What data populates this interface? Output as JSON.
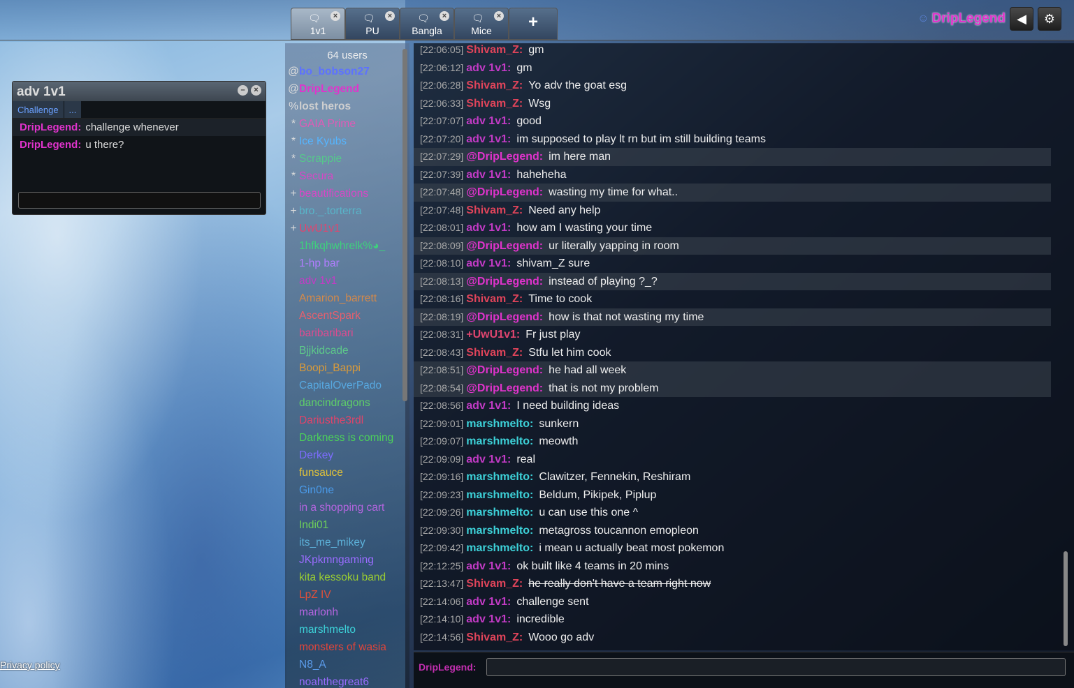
{
  "tabs": [
    {
      "label": "1v1",
      "active": true
    },
    {
      "label": "PU",
      "active": false
    },
    {
      "label": "Bangla",
      "active": false
    },
    {
      "label": "Mice",
      "active": false
    }
  ],
  "newtab_icon": "+",
  "header": {
    "username": "DripLegend",
    "user_icon": "user-icon",
    "sound_icon": "speaker-icon",
    "settings_icon": "gear-icon"
  },
  "pm": {
    "title": "adv 1v1",
    "tabs": [
      "Challenge",
      "..."
    ],
    "messages": [
      {
        "name": "DripLegend:",
        "text": "challenge whenever"
      },
      {
        "name": "DripLegend:",
        "text": "u there?"
      }
    ]
  },
  "privacy": "Privacy policy",
  "userlist": {
    "count": "64 users",
    "users": [
      {
        "rank": "@",
        "name": "bo_bobson27",
        "color": "#5d72ff",
        "bold": true
      },
      {
        "rank": "@",
        "name": "DripLegend",
        "color": "#e033cc",
        "bold": true
      },
      {
        "rank": "%",
        "name": "lost heros",
        "color": "#cfcfcf",
        "bold": true
      },
      {
        "rank": "*",
        "name": "GAIA Prime",
        "color": "#e05ab7"
      },
      {
        "rank": "*",
        "name": "Ice Kyubs",
        "color": "#55b5ff"
      },
      {
        "rank": "*",
        "name": "Scrappie",
        "color": "#55c98a"
      },
      {
        "rank": "*",
        "name": "Secura",
        "color": "#d946c6"
      },
      {
        "rank": "+",
        "name": "beautifications",
        "color": "#d946c6"
      },
      {
        "rank": "+",
        "name": "bro._.torterra",
        "color": "#58b5c9"
      },
      {
        "rank": "+",
        "name": "UwU1v1",
        "color": "#e0456f"
      },
      {
        "rank": "",
        "name": "1hfkqhwhrelk%◕_",
        "color": "#3ed17c"
      },
      {
        "rank": "",
        "name": "1-hp bar",
        "color": "#b17dff"
      },
      {
        "rank": "",
        "name": "adv 1v1",
        "color": "#c33bc6"
      },
      {
        "rank": "",
        "name": "Amarion_barrett",
        "color": "#d4894a"
      },
      {
        "rank": "",
        "name": "AscentSpark",
        "color": "#e85f6d"
      },
      {
        "rank": "",
        "name": "baribaribari",
        "color": "#e04a8f"
      },
      {
        "rank": "",
        "name": "Bjjkidcade",
        "color": "#5dc98a"
      },
      {
        "rank": "",
        "name": "Boopi_Bappi",
        "color": "#d99a3a"
      },
      {
        "rank": "",
        "name": "CapitalOverPado",
        "color": "#57a8e0"
      },
      {
        "rank": "",
        "name": "dancindragons",
        "color": "#5fcf68"
      },
      {
        "rank": "",
        "name": "Dariusthe3rdl",
        "color": "#e0446a"
      },
      {
        "rank": "",
        "name": "Darkness is coming",
        "color": "#4cd05a"
      },
      {
        "rank": "",
        "name": "Derkey",
        "color": "#7d6cff"
      },
      {
        "rank": "",
        "name": "funsauce",
        "color": "#e0c23a"
      },
      {
        "rank": "",
        "name": "Gin0ne",
        "color": "#4a9ae8"
      },
      {
        "rank": "",
        "name": "in a shopping cart",
        "color": "#b565e0"
      },
      {
        "rank": "",
        "name": "Indi01",
        "color": "#6ecf5a"
      },
      {
        "rank": "",
        "name": "its_me_mikey",
        "color": "#5cb0d8"
      },
      {
        "rank": "",
        "name": "JKpkmngaming",
        "color": "#9a6cff"
      },
      {
        "rank": "",
        "name": "kita kessoku band",
        "color": "#9acd32"
      },
      {
        "rank": "",
        "name": "LpZ IV",
        "color": "#e0503a"
      },
      {
        "rank": "",
        "name": "marlonh",
        "color": "#b565e0"
      },
      {
        "rank": "",
        "name": "marshmelto",
        "color": "#3dd1d8"
      },
      {
        "rank": "",
        "name": "monsters of wasia",
        "color": "#e0453a"
      },
      {
        "rank": "",
        "name": "N8_A",
        "color": "#5a9ae8"
      },
      {
        "rank": "",
        "name": "noahthegreat6",
        "color": "#9a6cff"
      }
    ]
  },
  "chat": [
    {
      "ts": "[22:06:05]",
      "nick": "Shivam_Z:",
      "color": "#e0445a",
      "text": "gm",
      "me": false
    },
    {
      "ts": "[22:06:12]",
      "nick": "adv 1v1:",
      "color": "#c33bc6",
      "text": "gm",
      "me": false
    },
    {
      "ts": "[22:06:28]",
      "nick": "Shivam_Z:",
      "color": "#e0445a",
      "text": "Yo adv the goat esg",
      "me": false
    },
    {
      "ts": "[22:06:33]",
      "nick": "Shivam_Z:",
      "color": "#e0445a",
      "text": "Wsg",
      "me": false
    },
    {
      "ts": "[22:07:07]",
      "nick": "adv 1v1:",
      "color": "#c33bc6",
      "text": "good",
      "me": false
    },
    {
      "ts": "[22:07:20]",
      "nick": "adv 1v1:",
      "color": "#c33bc6",
      "text": "im supposed to play lt rn but im still building teams",
      "me": false
    },
    {
      "ts": "[22:07:29]",
      "nick": "@DripLegend:",
      "color": "#e033cc",
      "text": "im here man",
      "me": true
    },
    {
      "ts": "[22:07:39]",
      "nick": "adv 1v1:",
      "color": "#c33bc6",
      "text": "haheheha",
      "me": false
    },
    {
      "ts": "[22:07:48]",
      "nick": "@DripLegend:",
      "color": "#e033cc",
      "text": "wasting my time for what..",
      "me": true
    },
    {
      "ts": "[22:07:48]",
      "nick": "Shivam_Z:",
      "color": "#e0445a",
      "text": "Need any help",
      "me": false
    },
    {
      "ts": "[22:08:01]",
      "nick": "adv 1v1:",
      "color": "#c33bc6",
      "text": "how am I wasting your time",
      "me": false
    },
    {
      "ts": "[22:08:09]",
      "nick": "@DripLegend:",
      "color": "#e033cc",
      "text": "ur literally yapping in room",
      "me": true
    },
    {
      "ts": "[22:08:10]",
      "nick": "adv 1v1:",
      "color": "#c33bc6",
      "text": "shivam_Z sure",
      "me": false
    },
    {
      "ts": "[22:08:13]",
      "nick": "@DripLegend:",
      "color": "#e033cc",
      "text": "instead of playing ?_?",
      "me": true
    },
    {
      "ts": "[22:08:16]",
      "nick": "Shivam_Z:",
      "color": "#e0445a",
      "text": "Time to cook",
      "me": false
    },
    {
      "ts": "[22:08:19]",
      "nick": "@DripLegend:",
      "color": "#e033cc",
      "text": "how is that not wasting my time",
      "me": true
    },
    {
      "ts": "[22:08:31]",
      "nick": "+UwU1v1:",
      "color": "#e0456f",
      "text": "Fr just play",
      "me": false
    },
    {
      "ts": "[22:08:43]",
      "nick": "Shivam_Z:",
      "color": "#e0445a",
      "text": "Stfu let him cook",
      "me": false
    },
    {
      "ts": "[22:08:51]",
      "nick": "@DripLegend:",
      "color": "#e033cc",
      "text": "he had all week",
      "me": true
    },
    {
      "ts": "[22:08:54]",
      "nick": "@DripLegend:",
      "color": "#e033cc",
      "text": "that is not my problem",
      "me": true
    },
    {
      "ts": "[22:08:56]",
      "nick": "adv 1v1:",
      "color": "#c33bc6",
      "text": "I need building ideas",
      "me": false
    },
    {
      "ts": "[22:09:01]",
      "nick": "marshmelto:",
      "color": "#3dd1d8",
      "text": "sunkern",
      "me": false
    },
    {
      "ts": "[22:09:07]",
      "nick": "marshmelto:",
      "color": "#3dd1d8",
      "text": "meowth",
      "me": false
    },
    {
      "ts": "[22:09:09]",
      "nick": "adv 1v1:",
      "color": "#c33bc6",
      "text": "real",
      "me": false
    },
    {
      "ts": "[22:09:16]",
      "nick": "marshmelto:",
      "color": "#3dd1d8",
      "text": "Clawitzer, Fennekin, Reshiram",
      "me": false
    },
    {
      "ts": "[22:09:23]",
      "nick": "marshmelto:",
      "color": "#3dd1d8",
      "text": "Beldum, Pikipek, Piplup",
      "me": false
    },
    {
      "ts": "[22:09:26]",
      "nick": "marshmelto:",
      "color": "#3dd1d8",
      "text": "u can use this one ^",
      "me": false
    },
    {
      "ts": "[22:09:30]",
      "nick": "marshmelto:",
      "color": "#3dd1d8",
      "text": "metagross toucannon emopleon",
      "me": false
    },
    {
      "ts": "[22:09:42]",
      "nick": "marshmelto:",
      "color": "#3dd1d8",
      "text": "i mean u actually beat most pokemon",
      "me": false
    },
    {
      "ts": "[22:12:25]",
      "nick": "adv 1v1:",
      "color": "#c33bc6",
      "text": "ok built like 4 teams in 20 mins",
      "me": false
    },
    {
      "ts": "[22:13:47]",
      "nick": "Shivam_Z:",
      "color": "#e0445a",
      "text": "he really don't have a team right now",
      "me": false,
      "strike": true
    },
    {
      "ts": "[22:14:06]",
      "nick": "adv 1v1:",
      "color": "#c33bc6",
      "text": "challenge sent",
      "me": false
    },
    {
      "ts": "[22:14:10]",
      "nick": "adv 1v1:",
      "color": "#c33bc6",
      "text": "incredible",
      "me": false
    },
    {
      "ts": "[22:14:56]",
      "nick": "Shivam_Z:",
      "color": "#e0445a",
      "text": "Wooo go adv",
      "me": false
    }
  ],
  "chatbar": {
    "label": "DripLegend:"
  }
}
